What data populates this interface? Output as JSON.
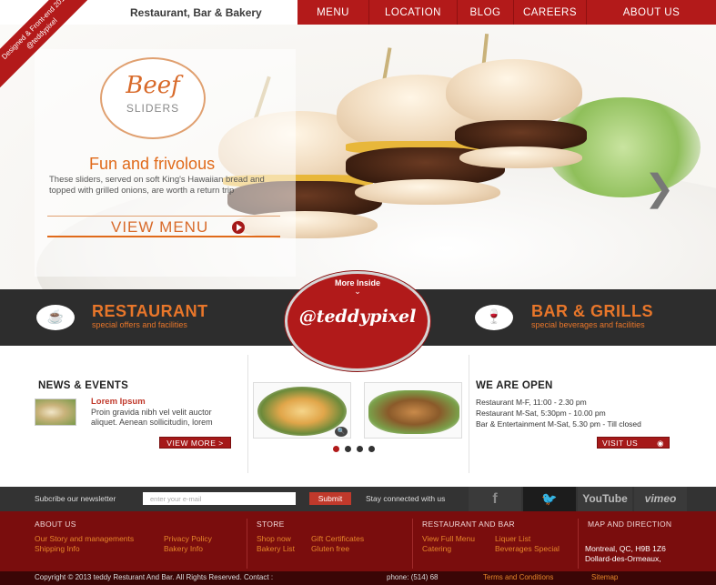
{
  "header": {
    "brand_line": "Restaurant, Bar & Bakery",
    "ribbon_line1": "Designed & Front-end 2013",
    "ribbon_line2": "@teddypixel",
    "nav": [
      "MENU",
      "LOCATION",
      "BLOG",
      "CAREERS",
      "ABOUT US"
    ]
  },
  "hero": {
    "badge_title": "Beef",
    "badge_subtitle": "SLIDERS",
    "title": "Fun and frivolous",
    "text": "These sliders, served on soft King's Hawaiian bread and topped with grilled onions, are worth a return trip",
    "cta": "VIEW MENU"
  },
  "band": {
    "left_title": "RESTAURANT",
    "left_sub": "special offers and facilities",
    "center_label": "More Inside",
    "center_handle": "@teddypixel",
    "right_title": "BAR & GRILLS",
    "right_sub": "special beverages and facilities"
  },
  "news": {
    "heading": "NEWS & EVENTS",
    "item_title": "Lorem Ipsum",
    "item_text": "Proin gravida nibh vel velit auctor aliquet. Aenean sollicitudin, lorem",
    "button": "VIEW MORE  >"
  },
  "gallery": {
    "active_dot": 0,
    "dot_count": 4
  },
  "hours": {
    "heading": "WE ARE OPEN",
    "lines": [
      "Restaurant M-F, 11:00 - 2.30 pm",
      "Restaurant M-Sat, 5:30pm - 10.00 pm",
      "Bar & Entertainment M-Sat, 5.30 pm - Till closed"
    ],
    "button": "VISIT US"
  },
  "newsletter": {
    "label": "Subcribe our newsletter",
    "placeholder": "enter your e-mail",
    "submit": "Submit",
    "stay_connected": "Stay connected with us",
    "socials": [
      "f",
      "t",
      "YouTube",
      "vimeo"
    ]
  },
  "footer": {
    "col1_head": "ABOUT US",
    "col1_links": [
      "Our Story and managements",
      "Shipping Info",
      "Privacy Policy",
      "Bakery Info"
    ],
    "col2_head": "STORE",
    "col2_links": [
      "Shop now",
      "Bakery List",
      "Gift Certificates",
      "Gluten free"
    ],
    "col3_head": "RESTAURANT AND BAR",
    "col3_links": [
      "View Full Menu",
      "Catering",
      "Liquer List",
      "Beverages Special"
    ],
    "col4_head": "MAP AND DIRECTION",
    "address1": "Montreal, QC, H9B 1Z6",
    "address2": "Dollard-des-Ormeaux,",
    "copyright": "Copyright © 2013  teddy Resturant And Bar. All Rights Reserved. Contact :",
    "phone": "phone: (514) 68",
    "terms": "Terms and Conditions",
    "sitemap": "Sitemap"
  },
  "colors": {
    "accent": "#b31a1a",
    "orange": "#e06a1a",
    "dark": "#2d2d2d",
    "footer": "#7a0d0d"
  }
}
